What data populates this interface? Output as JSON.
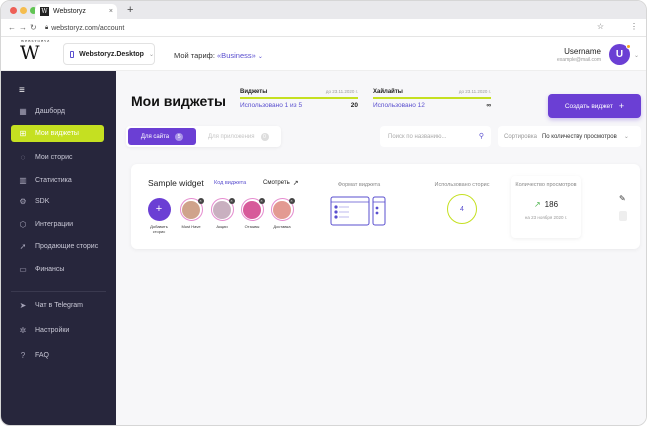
{
  "browser": {
    "tab_title": "Webstoryz",
    "url": "webstoryz.com/account"
  },
  "header": {
    "logo_text": "W",
    "logo_caption": "WEBSTORYZ",
    "project": "Webstoryz.Desktop",
    "tariff_label": "Мой тариф:",
    "tariff_value": "«Business»",
    "username": "Username",
    "email": "example@mail.com",
    "avatar_letter": "U"
  },
  "sidebar": {
    "items": [
      {
        "label": "Дашборд",
        "icon": "dashboard-icon"
      },
      {
        "label": "Мои виджеты",
        "icon": "widgets-icon"
      },
      {
        "label": "Мои сторис",
        "icon": "stories-icon"
      },
      {
        "label": "Статистика",
        "icon": "stats-icon"
      },
      {
        "label": "SDK",
        "icon": "sdk-icon"
      },
      {
        "label": "Интеграции",
        "icon": "integrations-icon"
      },
      {
        "label": "Продающие сторис",
        "icon": "rocket-icon"
      },
      {
        "label": "Финансы",
        "icon": "finance-icon"
      },
      {
        "label": "Чат в Telegram",
        "icon": "telegram-icon"
      },
      {
        "label": "Настройки",
        "icon": "settings-icon"
      },
      {
        "label": "FAQ",
        "icon": "faq-icon"
      }
    ],
    "active_index": 1
  },
  "main": {
    "title": "Мои виджеты",
    "limits": [
      {
        "name": "Виджеты",
        "until": "до 23.11.2020 г.",
        "used": "Использовано 1 из 5",
        "value": "20"
      },
      {
        "name": "Хайлайты",
        "until": "до 23.11.2020 г.",
        "used": "Использовано 12",
        "value": "∞"
      }
    ],
    "create_button": "Создать виджет",
    "toggle": {
      "site_label": "Для сайта",
      "site_count": "5",
      "app_label": "Для приложения",
      "app_count": "0"
    },
    "search_placeholder": "Поиск по названию...",
    "sort_label": "Сортировка",
    "sort_value": "По количеству просмотров"
  },
  "widget": {
    "name": "Sample widget",
    "code_link": "Код виджета",
    "view_link": "Смотреть",
    "stories": [
      {
        "label": "Добавить сторис",
        "type": "add"
      },
      {
        "label": "Must Have",
        "color": "#cfa38b"
      },
      {
        "label": "Акции",
        "color": "#c9b0c0"
      },
      {
        "label": "Отзывы",
        "color": "#d75a9a"
      },
      {
        "label": "Доставка",
        "color": "#e39a92"
      }
    ],
    "format_title": "Формат виджета",
    "used_title": "Использовано сторис",
    "used_value": "4",
    "views_title": "Количество просмотров",
    "views_value": "186",
    "views_date": "на 23 ноября 2020 г."
  }
}
